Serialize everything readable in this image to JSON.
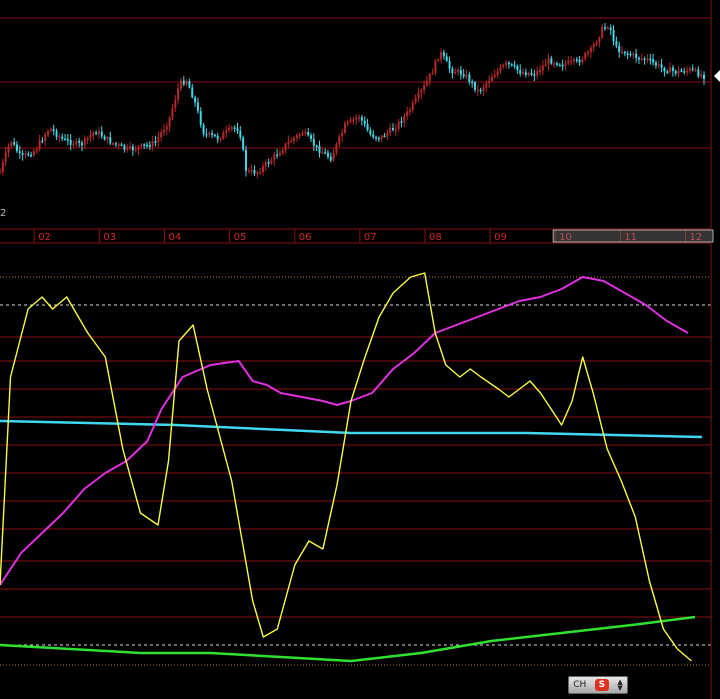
{
  "chart_data": [
    {
      "type": "candlestick",
      "x_months": [
        "02",
        "03",
        "04",
        "05",
        "06",
        "07",
        "08",
        "09",
        "10",
        "11",
        "12"
      ],
      "highlighted_months": [
        "10",
        "11",
        "12"
      ],
      "partial_left_label": "2",
      "colors": {
        "up": "#b82828",
        "down": "#40d8e8",
        "gridline": "#8a1010",
        "axis_label": "#d02828"
      },
      "close_path": [
        [
          0.0,
          172
        ],
        [
          1.5,
          140
        ],
        [
          3.0,
          158
        ],
        [
          5.0,
          150
        ],
        [
          7.0,
          128
        ],
        [
          9.0,
          140
        ],
        [
          11.5,
          145
        ],
        [
          13.5,
          131
        ],
        [
          16.0,
          143
        ],
        [
          18.0,
          150
        ],
        [
          20.0,
          147
        ],
        [
          22.0,
          143
        ],
        [
          24.0,
          120
        ],
        [
          25.5,
          84
        ],
        [
          26.5,
          80
        ],
        [
          27.5,
          98
        ],
        [
          29.0,
          134
        ],
        [
          31.0,
          138
        ],
        [
          33.0,
          128
        ],
        [
          34.0,
          129
        ],
        [
          35.0,
          172
        ],
        [
          36.5,
          172
        ],
        [
          38.5,
          160
        ],
        [
          41.0,
          142
        ],
        [
          43.0,
          132
        ],
        [
          45.0,
          148
        ],
        [
          47.0,
          158
        ],
        [
          49.0,
          126
        ],
        [
          51.0,
          116
        ],
        [
          52.5,
          134
        ],
        [
          54.0,
          138
        ],
        [
          56.0,
          128
        ],
        [
          58.0,
          112
        ],
        [
          60.0,
          90
        ],
        [
          61.5,
          70
        ],
        [
          62.5,
          52
        ],
        [
          64.0,
          70
        ],
        [
          66.0,
          74
        ],
        [
          68.0,
          92
        ],
        [
          70.0,
          75
        ],
        [
          72.0,
          64
        ],
        [
          74.0,
          72
        ],
        [
          76.0,
          74
        ],
        [
          78.0,
          60
        ],
        [
          80.0,
          64
        ],
        [
          82.0,
          62
        ],
        [
          84.0,
          50
        ],
        [
          85.5,
          30
        ],
        [
          86.5,
          24
        ],
        [
          87.5,
          48
        ],
        [
          90.0,
          56
        ],
        [
          92.0,
          60
        ],
        [
          94.0,
          68
        ],
        [
          96.0,
          72
        ],
        [
          98.0,
          70
        ],
        [
          100.0,
          76
        ]
      ],
      "last_price_marker": "white-triangle"
    },
    {
      "type": "line",
      "series": [
        {
          "color": "#fbfb40",
          "points": [
            [
              0.0,
              0.2
            ],
            [
              1.5,
              0.72
            ],
            [
              4.0,
              0.89
            ],
            [
              6.0,
              0.92
            ],
            [
              7.5,
              0.89
            ],
            [
              9.5,
              0.92
            ],
            [
              12.5,
              0.83
            ],
            [
              15.0,
              0.77
            ],
            [
              17.5,
              0.54
            ],
            [
              20.0,
              0.38
            ],
            [
              22.5,
              0.35
            ],
            [
              24.0,
              0.51
            ],
            [
              25.5,
              0.81
            ],
            [
              27.5,
              0.85
            ],
            [
              29.5,
              0.69
            ],
            [
              33.0,
              0.46
            ],
            [
              36.0,
              0.16
            ],
            [
              37.5,
              0.07
            ],
            [
              39.5,
              0.09
            ],
            [
              42.0,
              0.25
            ],
            [
              44.0,
              0.31
            ],
            [
              46.0,
              0.29
            ],
            [
              48.0,
              0.45
            ],
            [
              50.0,
              0.66
            ],
            [
              52.0,
              0.77
            ],
            [
              54.0,
              0.87
            ],
            [
              56.0,
              0.93
            ],
            [
              58.5,
              0.97
            ],
            [
              60.5,
              0.98
            ],
            [
              62.0,
              0.83
            ],
            [
              63.5,
              0.75
            ],
            [
              65.5,
              0.72
            ],
            [
              67.0,
              0.74
            ],
            [
              68.5,
              0.72
            ],
            [
              71.0,
              0.69
            ],
            [
              72.5,
              0.67
            ],
            [
              74.0,
              0.69
            ],
            [
              75.5,
              0.71
            ],
            [
              77.0,
              0.68
            ],
            [
              78.5,
              0.64
            ],
            [
              80.0,
              0.6
            ],
            [
              81.5,
              0.66
            ],
            [
              83.0,
              0.77
            ],
            [
              84.5,
              0.68
            ],
            [
              86.5,
              0.54
            ],
            [
              88.5,
              0.46
            ],
            [
              90.5,
              0.37
            ],
            [
              92.5,
              0.21
            ],
            [
              94.5,
              0.09
            ],
            [
              96.5,
              0.04
            ],
            [
              98.5,
              0.01
            ]
          ]
        },
        {
          "color": "#e030e0",
          "points": [
            [
              0.0,
              0.2
            ],
            [
              3.0,
              0.28
            ],
            [
              6.0,
              0.33
            ],
            [
              9.0,
              0.38
            ],
            [
              12.0,
              0.44
            ],
            [
              15.0,
              0.48
            ],
            [
              18.0,
              0.51
            ],
            [
              21.0,
              0.56
            ],
            [
              23.0,
              0.64
            ],
            [
              26.0,
              0.72
            ],
            [
              30.0,
              0.75
            ],
            [
              34.0,
              0.76
            ],
            [
              36.0,
              0.71
            ],
            [
              38.0,
              0.7
            ],
            [
              40.0,
              0.68
            ],
            [
              43.0,
              0.67
            ],
            [
              46.0,
              0.66
            ],
            [
              48.0,
              0.65
            ],
            [
              50.0,
              0.66
            ],
            [
              53.0,
              0.68
            ],
            [
              56.0,
              0.74
            ],
            [
              59.0,
              0.78
            ],
            [
              62.0,
              0.83
            ],
            [
              65.0,
              0.85
            ],
            [
              68.0,
              0.87
            ],
            [
              71.0,
              0.89
            ],
            [
              74.0,
              0.91
            ],
            [
              77.0,
              0.92
            ],
            [
              80.0,
              0.94
            ],
            [
              83.0,
              0.97
            ],
            [
              86.0,
              0.96
            ],
            [
              89.0,
              0.93
            ],
            [
              92.0,
              0.9
            ],
            [
              95.0,
              0.86
            ],
            [
              98.0,
              0.83
            ]
          ]
        },
        {
          "color": "#40d8f0",
          "points": [
            [
              0.0,
              0.61
            ],
            [
              25.0,
              0.6
            ],
            [
              50.0,
              0.58
            ],
            [
              75.0,
              0.58
            ],
            [
              100.0,
              0.57
            ]
          ]
        },
        {
          "color": "#30e030",
          "points": [
            [
              0.0,
              0.05
            ],
            [
              10.0,
              0.04
            ],
            [
              20.0,
              0.03
            ],
            [
              30.0,
              0.03
            ],
            [
              40.0,
              0.02
            ],
            [
              50.0,
              0.01
            ],
            [
              55.0,
              0.02
            ],
            [
              60.0,
              0.03
            ],
            [
              70.0,
              0.06
            ],
            [
              80.0,
              0.08
            ],
            [
              90.0,
              0.1
            ],
            [
              99.0,
              0.12
            ]
          ]
        }
      ],
      "reference_lines": [
        {
          "level": 0.97,
          "style": "dotted",
          "color": "#c07830"
        },
        {
          "level": 0.9,
          "style": "dashed",
          "color": "#d8d8d8"
        },
        {
          "level": 0.05,
          "style": "dashed",
          "color": "#d8d8d8"
        },
        {
          "level": 0.0,
          "style": "dotted",
          "color": "#c07830"
        }
      ],
      "grid_levels": [
        0.82,
        0.76,
        0.69,
        0.62,
        0.55,
        0.48,
        0.41,
        0.34,
        0.26,
        0.19,
        0.12
      ],
      "grid_color": "#8a1010"
    }
  ],
  "ime_widget": {
    "label": "CH",
    "logo": "S",
    "arrows": "updown-arrows-icon"
  }
}
